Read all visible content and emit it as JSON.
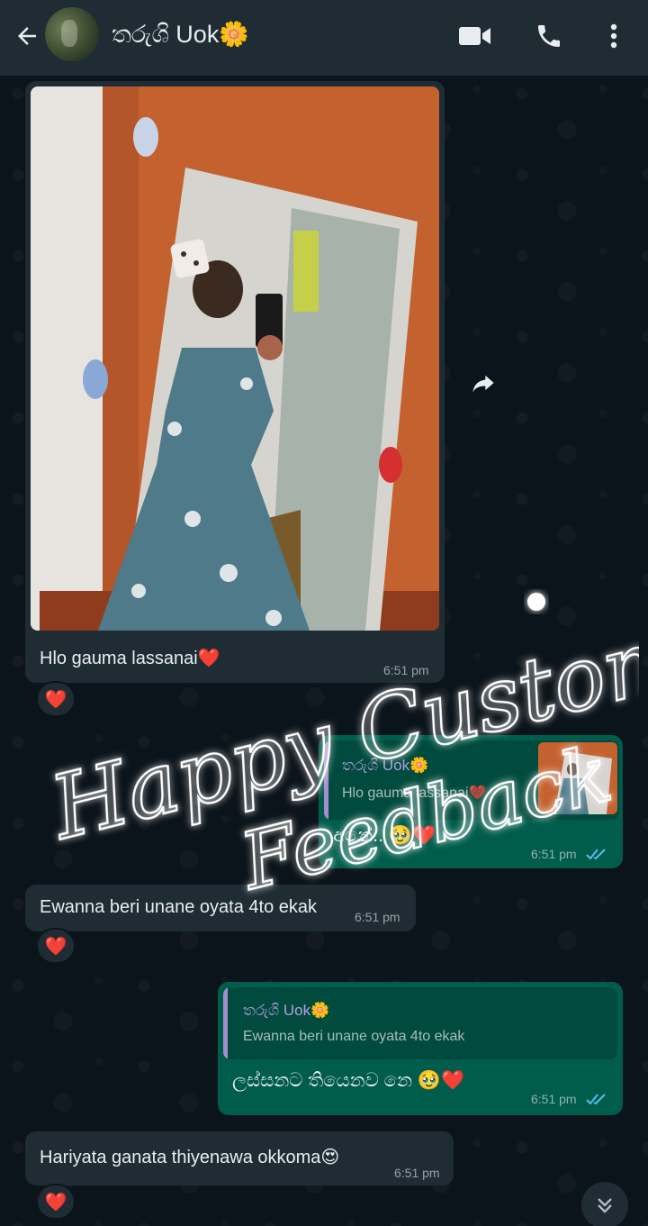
{
  "header": {
    "contact_name": "තරුශි Uok🌼"
  },
  "messages": [
    {
      "type": "image",
      "caption": "Hlo gauma lassanai❤️",
      "time": "6:51 pm",
      "reaction": "❤️"
    },
    {
      "type": "outgoing",
      "quote_name": "තරුශි Uok🌼",
      "quote_text": "Hlo gauma lassanai❤️",
      "text": "අනේ.. 🥹❤️",
      "time": "6:51 pm"
    },
    {
      "type": "incoming",
      "text": "Ewanna beri unane oyata 4to ekak",
      "time": "6:51 pm",
      "reaction": "❤️"
    },
    {
      "type": "outgoing",
      "quote_name": "තරුශි Uok🌼",
      "quote_text": "Ewanna beri unane oyata 4to ekak",
      "text": "ලස්සනට තියෙනව නෙ 🥹❤️",
      "time": "6:51 pm"
    },
    {
      "type": "incoming",
      "text": "Hariyata ganata thiyenawa okkoma😍",
      "time": "6:51 pm",
      "reaction": "❤️"
    }
  ],
  "overlay": {
    "line1": "Happy Customer",
    "line2": "Feedback"
  },
  "colors": {
    "header_bg": "#1f2c34",
    "chat_bg": "#0b141a",
    "incoming_bubble": "#1f2c34",
    "outgoing_bubble": "#005c4b",
    "read_ticks": "#53bdeb",
    "quote_name": "#b49ce6"
  },
  "icons": {
    "back": "arrow-left-icon",
    "video": "video-camera-icon",
    "call": "phone-icon",
    "menu": "more-vertical-icon",
    "forward": "forward-arrow-icon",
    "scroll": "double-chevron-down-icon"
  }
}
